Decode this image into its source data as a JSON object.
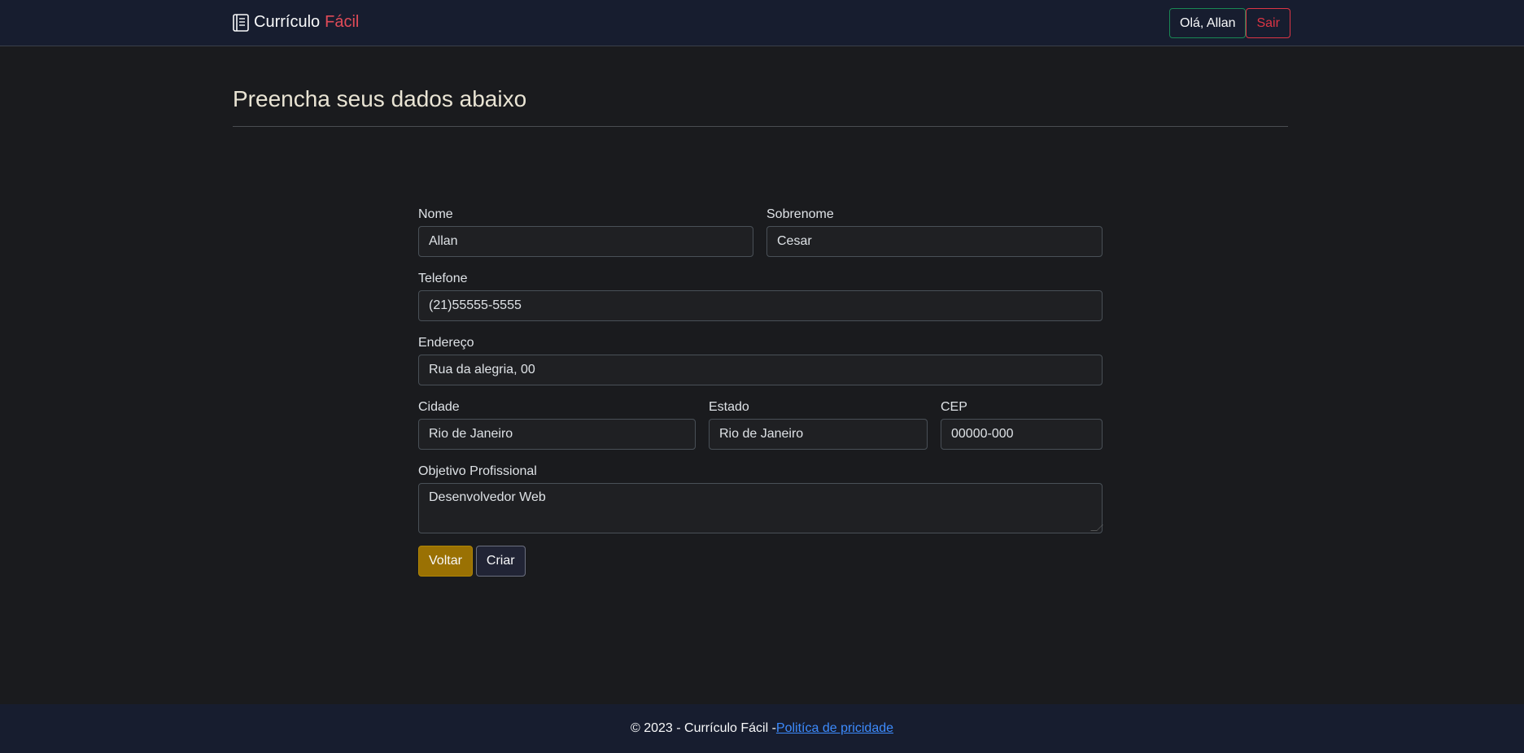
{
  "navbar": {
    "brand_main": "Currículo",
    "brand_accent": "Fácil",
    "greeting_button": "Olá, Allan",
    "logout_button": "Sair"
  },
  "page": {
    "title": "Preencha seus dados abaixo"
  },
  "form": {
    "nome": {
      "label": "Nome",
      "value": "Allan"
    },
    "sobrenome": {
      "label": "Sobrenome",
      "value": "Cesar"
    },
    "telefone": {
      "label": "Telefone",
      "value": "(21)55555-5555"
    },
    "endereco": {
      "label": "Endereço",
      "value": "Rua da alegria, 00"
    },
    "cidade": {
      "label": "Cidade",
      "value": "Rio de Janeiro"
    },
    "estado": {
      "label": "Estado",
      "value": "Rio de Janeiro"
    },
    "cep": {
      "label": "CEP",
      "value": "00000-000"
    },
    "objetivo": {
      "label": "Objetivo Profissional",
      "value": "Desenvolvedor Web"
    },
    "back_button": "Voltar",
    "create_button": "Criar"
  },
  "footer": {
    "copyright": "© 2023 - Currículo Fácil - ",
    "privacy_link": "Politíca de pricidade"
  },
  "colors": {
    "navbar_bg": "#171d2f",
    "page_bg": "#1a1b1e",
    "accent_red": "#e04b58",
    "warning": "#9a7103",
    "link": "#3d8bfd"
  }
}
